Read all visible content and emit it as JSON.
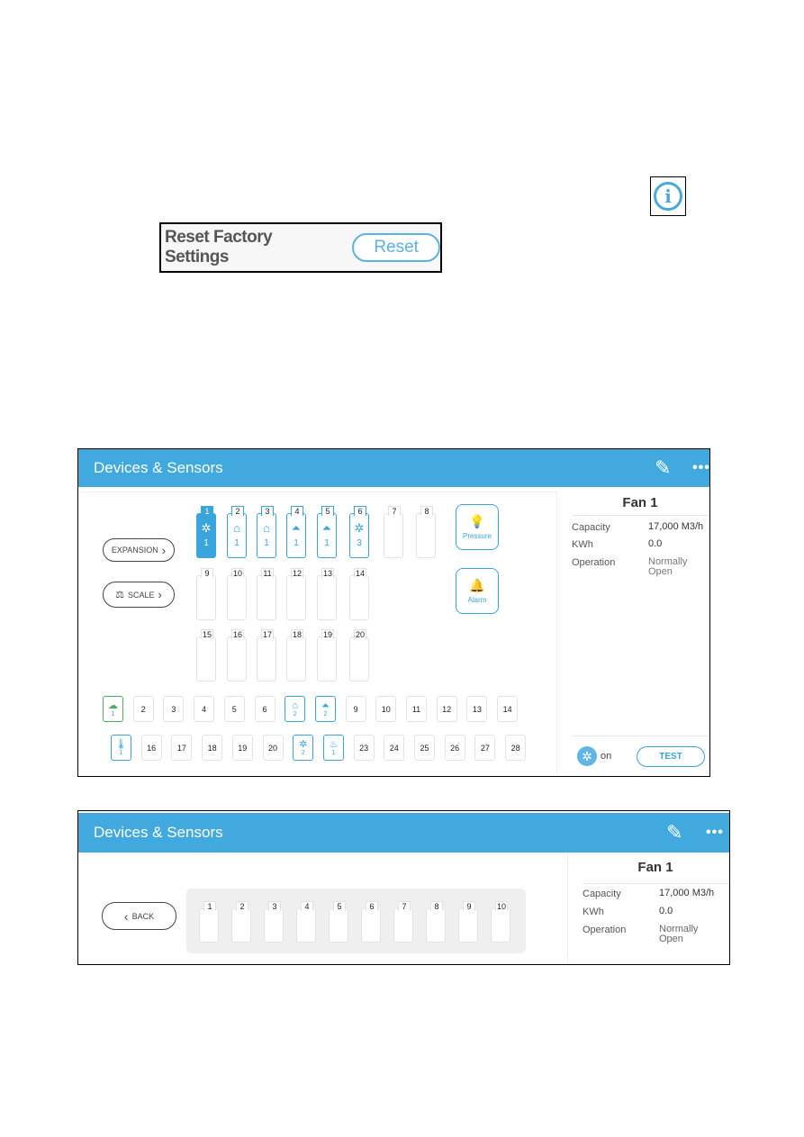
{
  "icons": {
    "info": "info-icon"
  },
  "reset": {
    "label": "Reset Factory Settings",
    "button": "Reset"
  },
  "screen1": {
    "title": "Devices & Sensors",
    "expansion": "EXPANSION",
    "scale": "SCALE",
    "relays": [
      {
        "num": "1",
        "icon": "fan",
        "count": "1",
        "state": "selected"
      },
      {
        "num": "2",
        "icon": "inlet",
        "count": "1",
        "state": "active"
      },
      {
        "num": "3",
        "icon": "inlet",
        "count": "1",
        "state": "active"
      },
      {
        "num": "4",
        "icon": "curtain",
        "count": "1",
        "state": "active"
      },
      {
        "num": "5",
        "icon": "curtain",
        "count": "1",
        "state": "active"
      },
      {
        "num": "6",
        "icon": "fan",
        "count": "3",
        "state": "active"
      },
      {
        "num": "7"
      },
      {
        "num": "8"
      },
      {
        "num": "9"
      },
      {
        "num": "10"
      },
      {
        "num": "11"
      },
      {
        "num": "12"
      },
      {
        "num": "13"
      },
      {
        "num": "14"
      },
      {
        "num": "15"
      },
      {
        "num": "16"
      },
      {
        "num": "17"
      },
      {
        "num": "18"
      },
      {
        "num": "19"
      },
      {
        "num": "20"
      }
    ],
    "pressure": "Pressure",
    "alarm": "Alarm",
    "inputs_row1": [
      {
        "num": "1",
        "icon": "weather",
        "state": "green"
      },
      {
        "num": "2"
      },
      {
        "num": "3"
      },
      {
        "num": "4"
      },
      {
        "num": "5"
      },
      {
        "num": "6"
      },
      {
        "num": "2",
        "icon": "inlet",
        "state": "active"
      },
      {
        "num": "2",
        "icon": "curtain",
        "state": "active"
      },
      {
        "num": "9"
      },
      {
        "num": "10"
      },
      {
        "num": "11"
      },
      {
        "num": "12"
      },
      {
        "num": "13"
      },
      {
        "num": "14"
      }
    ],
    "inputs_row2": [
      {
        "num": "1",
        "icon": "thermometer",
        "state": "active"
      },
      {
        "num": "16"
      },
      {
        "num": "17"
      },
      {
        "num": "18"
      },
      {
        "num": "19"
      },
      {
        "num": "20"
      },
      {
        "num": "2",
        "icon": "fan",
        "state": "active"
      },
      {
        "num": "1",
        "icon": "heater",
        "state": "active"
      },
      {
        "num": "23"
      },
      {
        "num": "24"
      },
      {
        "num": "25"
      },
      {
        "num": "26"
      },
      {
        "num": "27"
      },
      {
        "num": "28"
      }
    ],
    "panel": {
      "title": "Fan 1",
      "capacity_label": "Capacity",
      "capacity": "17,000 M3/h",
      "kwh_label": "KWh",
      "kwh": "0.0",
      "operation_label": "Operation",
      "operation": "Normally Open",
      "status": "on",
      "test": "TEST"
    }
  },
  "screen2": {
    "title": "Devices & Sensors",
    "back": "BACK",
    "slots": [
      "1",
      "2",
      "3",
      "4",
      "5",
      "6",
      "7",
      "8",
      "9",
      "10"
    ],
    "panel": {
      "title": "Fan 1",
      "capacity_label": "Capacity",
      "capacity": "17,000 M3/h",
      "kwh_label": "KWh",
      "kwh": "0.0",
      "operation_label": "Operation",
      "operation": "Normally Open"
    }
  },
  "colors": {
    "accent": "#42a9de",
    "active": "#3aa4dc",
    "green": "#4cae5a"
  }
}
